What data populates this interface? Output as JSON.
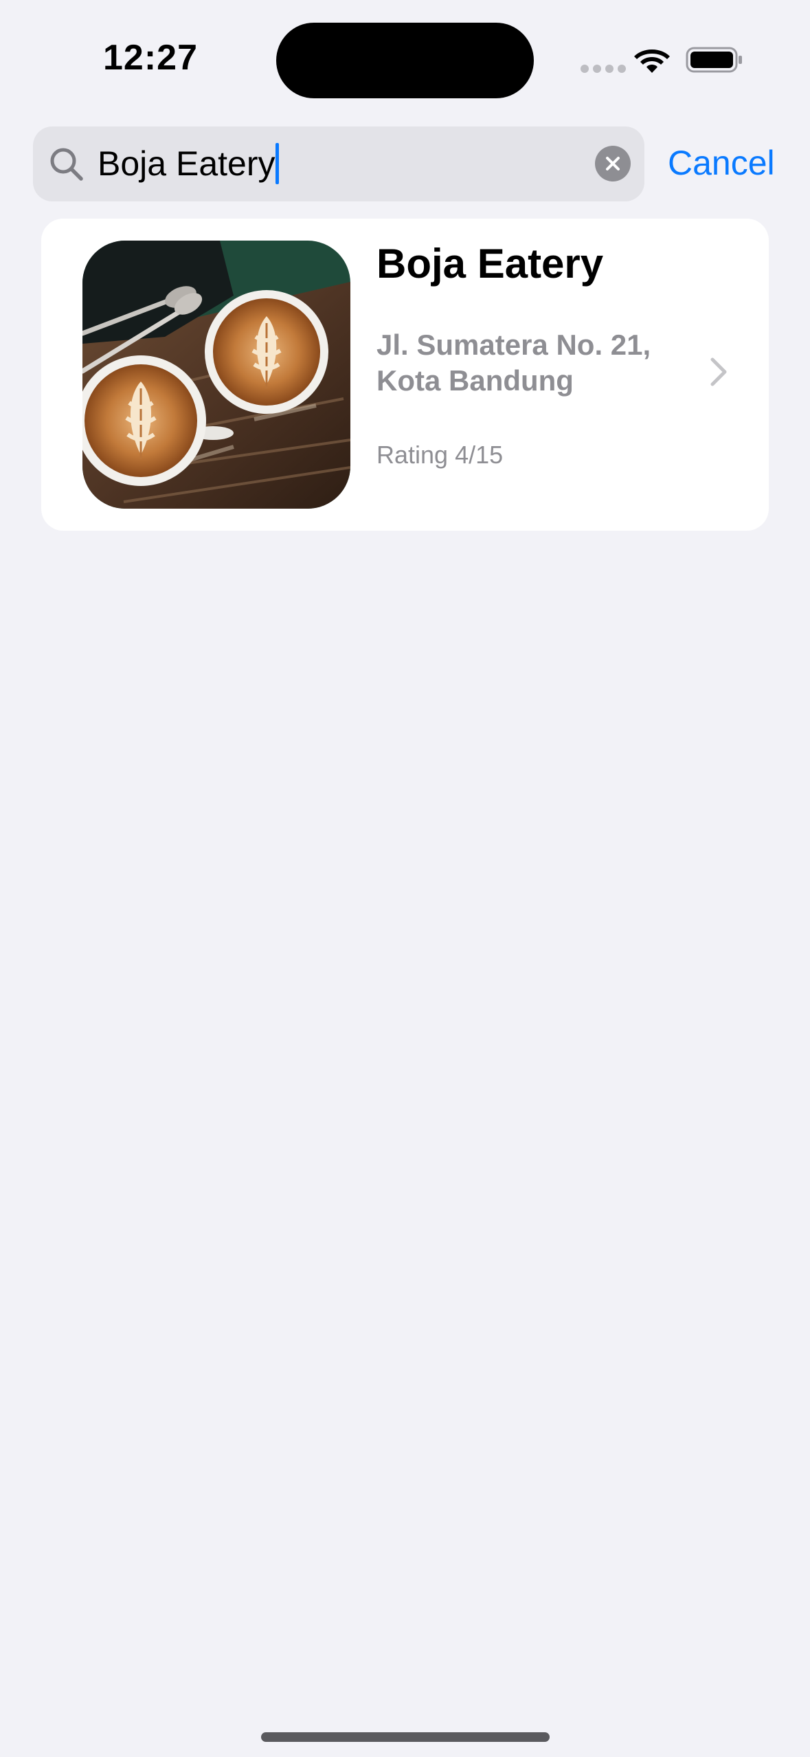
{
  "status_bar": {
    "time": "12:27"
  },
  "search": {
    "value": "Boja Eatery",
    "cancel_label": "Cancel"
  },
  "results": [
    {
      "title": "Boja Eatery",
      "address": "Jl. Sumatera No. 21, Kota Bandung",
      "rating": "Rating 4/15",
      "image": "latte-art-coffee-photo"
    }
  ],
  "icons": {
    "search": "search-icon",
    "clear": "clear-icon",
    "chevron": "chevron-right-icon",
    "wifi": "wifi-icon",
    "battery": "battery-icon"
  },
  "colors": {
    "background": "#F2F2F7",
    "accent": "#0A7AFF",
    "secondary_text": "#8E8E93",
    "search_field": "#E3E3E8"
  }
}
